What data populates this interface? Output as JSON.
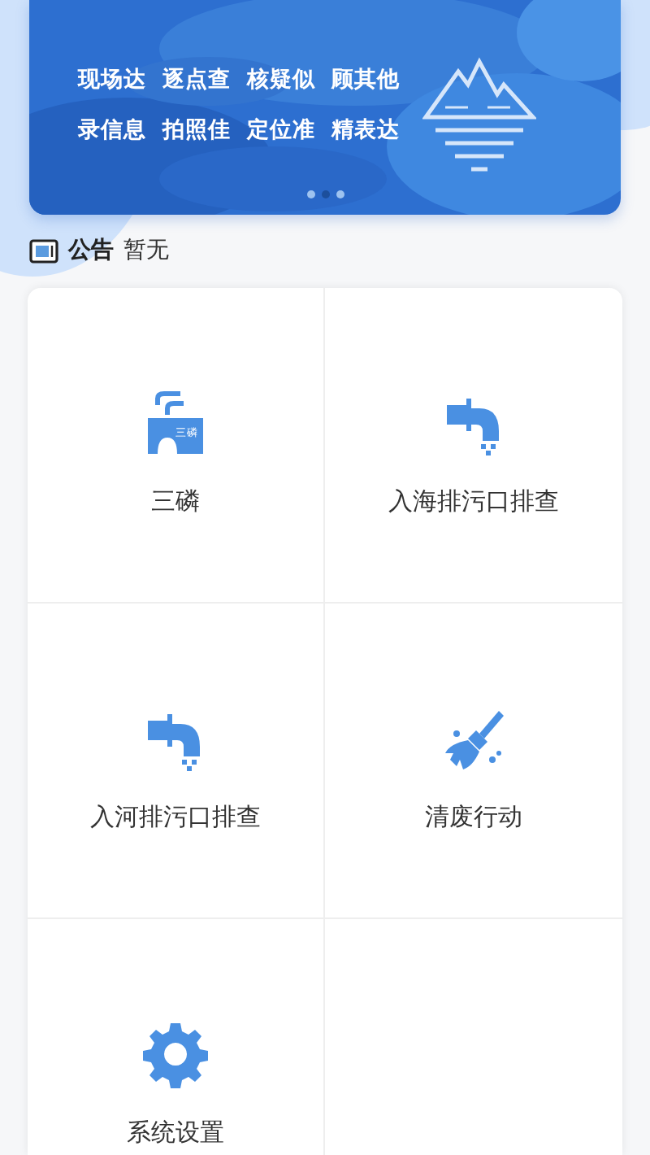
{
  "banner": {
    "slogans": [
      [
        "现场达",
        "逐点查",
        "核疑似",
        "顾其他"
      ],
      [
        "录信息",
        "拍照佳",
        "定位准",
        "精表达"
      ]
    ],
    "dots": [
      {
        "selected": false
      },
      {
        "selected": true
      },
      {
        "selected": false
      }
    ]
  },
  "notice": {
    "label": "公告",
    "text": "暂无"
  },
  "menu": [
    {
      "kind": "factory",
      "label": "三磷",
      "icon_text": "三磷"
    },
    {
      "kind": "pipe",
      "label": "入海排污口排查"
    },
    {
      "kind": "pipe",
      "label": "入河排污口排查"
    },
    {
      "kind": "broom",
      "label": "清废行动"
    },
    {
      "kind": "gear",
      "label": "系统设置"
    },
    {
      "kind": "empty"
    }
  ]
}
